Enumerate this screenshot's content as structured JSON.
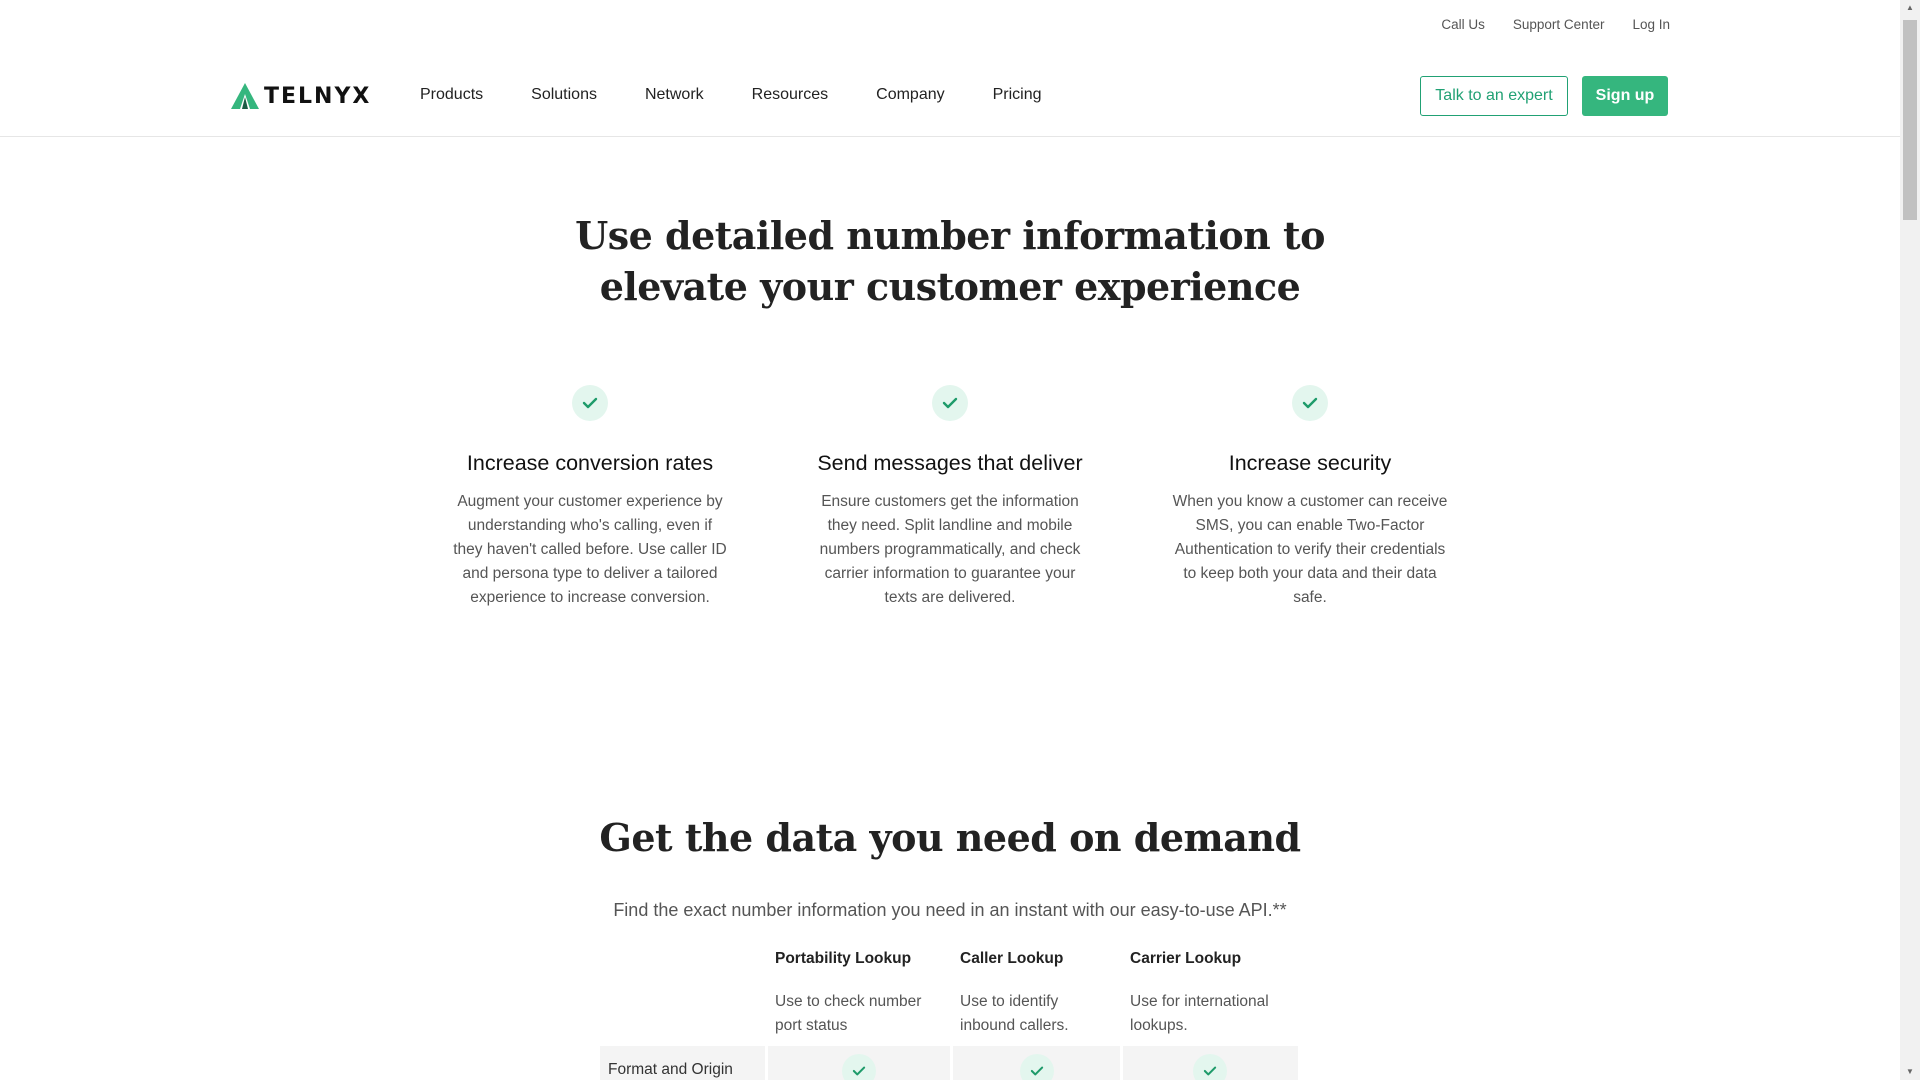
{
  "utility": {
    "call_us": "Call Us",
    "support_center": "Support Center",
    "log_in": "Log In"
  },
  "brand": {
    "logo_text": "TELNYX",
    "accent_color": "#35b67e"
  },
  "nav": {
    "items": [
      {
        "label": "Products"
      },
      {
        "label": "Solutions"
      },
      {
        "label": "Network"
      },
      {
        "label": "Resources"
      },
      {
        "label": "Company"
      },
      {
        "label": "Pricing"
      }
    ],
    "talk_label": "Talk to an expert",
    "signup_label": "Sign up"
  },
  "hero": {
    "title_line1": "Use detailed number information to",
    "title_line2": "elevate your customer experience"
  },
  "features": [
    {
      "icon": "check-icon",
      "title": "Increase conversion rates",
      "desc": "Augment your customer experience by understanding who's calling, even if they haven't called before. Use caller ID and persona type to deliver a tailored experience to increase conversion."
    },
    {
      "icon": "check-icon",
      "title": "Send messages that deliver",
      "desc": "Ensure customers get the information they need. Split landline and mobile numbers programmatically, and check carrier information to guarantee your texts are delivered."
    },
    {
      "icon": "check-icon",
      "title": "Increase security",
      "desc": "When you know a customer can receive SMS, you can enable Two-Factor Authentication to verify their credentials to keep both your data and their data safe."
    }
  ],
  "section2": {
    "title": "Get the data you need on demand",
    "subtitle": "Find the exact number information you need in an instant with our easy-to-use API.**"
  },
  "lookup_table": {
    "columns": [
      {
        "title": "Portability Lookup",
        "desc": "Use to check number port status"
      },
      {
        "title": "Caller Lookup",
        "desc": "Use to identify inbound callers."
      },
      {
        "title": "Carrier Lookup",
        "desc": "Use for international lookups."
      }
    ],
    "rows": [
      {
        "label": "Format and Origin",
        "values": [
          true,
          true,
          true
        ]
      }
    ]
  }
}
